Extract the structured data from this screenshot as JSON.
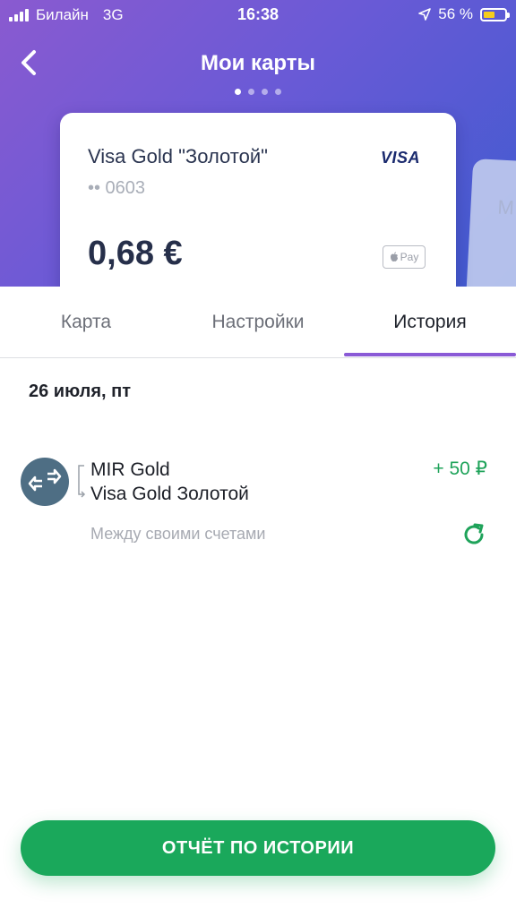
{
  "status": {
    "carrier": "Билайн",
    "network": "3G",
    "time": "16:38",
    "battery": "56 %",
    "battery_level": 0.56
  },
  "header": {
    "title": "Мои карты",
    "pager_total": 4,
    "pager_active": 1
  },
  "card": {
    "name": "Visa Gold \"Золотой\"",
    "number": "•• 0603",
    "brand": "VISA",
    "balance": "0,68 €",
    "wallet": "Pay"
  },
  "next_card": {
    "text_start": "M"
  },
  "tabs": [
    {
      "label": "Карта"
    },
    {
      "label": "Настройки"
    },
    {
      "label": "История"
    }
  ],
  "history": {
    "date": "26 июля, пт",
    "transactions": [
      {
        "from": "MIR Gold",
        "to": "Visa Gold Золотой",
        "amount": "+ 50 ₽",
        "description": "Между своими счетами"
      }
    ]
  },
  "report_button": {
    "label": "ОТЧЁТ ПО ИСТОРИИ"
  },
  "colors": {
    "accent": "#8a5ad6",
    "positive": "#1fa35a",
    "button": "#1aa85b"
  }
}
